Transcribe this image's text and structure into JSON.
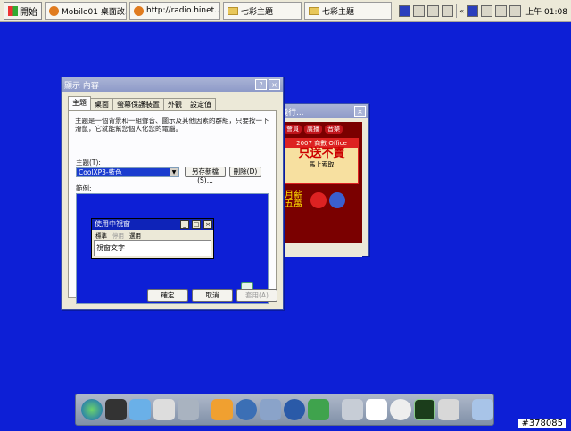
{
  "taskbar": {
    "start_label": "開始",
    "tasks": [
      {
        "label": "Mobile01 桌面改..."
      },
      {
        "label": "http://radio.hinet...."
      },
      {
        "label": "七彩主題"
      },
      {
        "label": "七彩主題"
      }
    ],
    "clock": "上午 01:08"
  },
  "dialog": {
    "title": "顯示 內容",
    "tabs": [
      "主題",
      "桌面",
      "螢幕保護裝置",
      "外觀",
      "設定值"
    ],
    "description": "主題是一個背景和一組聲音、圖示及其他因素的群組，只要按一下滑鼠，它就能幫您個人化您的電腦。",
    "theme_label": "主題(T):",
    "theme_value": "CoolXP3-藍色",
    "save_as_label": "另存新檔(S)...",
    "delete_label": "刪除(D)",
    "sample_label": "範例:",
    "preview": {
      "window_title": "使用中視窗",
      "menu": [
        "標準",
        "停用",
        "選用"
      ],
      "text": "視窗文字"
    },
    "ok_label": "確定",
    "cancel_label": "取消",
    "apply_label": "套用(A)"
  },
  "ad_window": {
    "title": "飛行...",
    "menu": [
      "會員",
      "廣播",
      "音樂"
    ],
    "banner_head": "2007 商數 Office",
    "banner_big": "只送不賣",
    "banner_sub": "馬上索取",
    "foot_text": "月薪五萬"
  },
  "watermark": "#378085",
  "colors": {
    "desktop": "#0d1fd6",
    "taskbar": "#ece9d8"
  }
}
